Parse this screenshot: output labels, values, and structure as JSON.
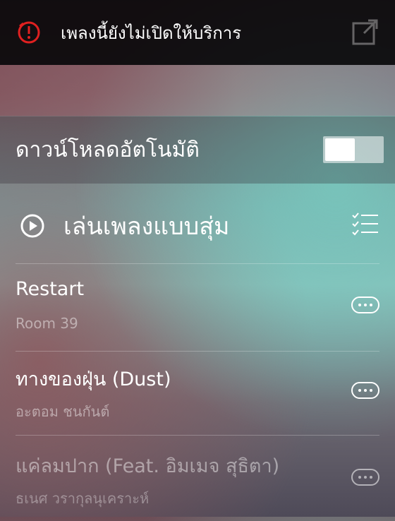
{
  "toast": {
    "message": "เพลงนี้ยังไม่เปิดให้บริการ",
    "alert_icon": "alert-clock-icon",
    "share_icon": "share-icon"
  },
  "auto_download": {
    "label": "ดาวน์โหลดอัตโนมัติ",
    "toggle_on": true
  },
  "shuffle": {
    "label": "เล่นเพลงแบบสุ่ม",
    "play_icon": "play-circle-icon",
    "list_icon": "checklist-icon"
  },
  "tracks": [
    {
      "title": "Restart",
      "artist": "Room 39",
      "available": true
    },
    {
      "title": "ทางของฝุ่น (Dust)",
      "artist": "อะตอม ชนกันต์",
      "available": true
    },
    {
      "title": "แค่ลมปาก (Feat. อิมเมจ สุธิตา)",
      "artist": "ธเนศ วรากุลนุเคราะห์",
      "available": false
    }
  ],
  "colors": {
    "toast_bg": "#0a080a",
    "alert_red": "#e02020"
  }
}
